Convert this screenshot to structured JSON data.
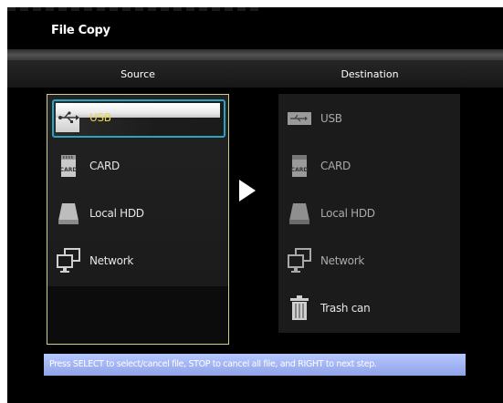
{
  "window": {
    "title": "File Copy"
  },
  "header": {
    "source_label": "Source",
    "destination_label": "Destination"
  },
  "source": {
    "selected_index": 0,
    "items": [
      {
        "label": "USB",
        "icon": "usb-icon"
      },
      {
        "label": "CARD",
        "icon": "card-icon"
      },
      {
        "label": "Local HDD",
        "icon": "hdd-icon"
      },
      {
        "label": "Network",
        "icon": "network-icon"
      }
    ]
  },
  "destination": {
    "items": [
      {
        "label": "USB",
        "icon": "usb-icon"
      },
      {
        "label": "CARD",
        "icon": "card-icon"
      },
      {
        "label": "Local HDD",
        "icon": "hdd-icon"
      },
      {
        "label": "Network",
        "icon": "network-icon"
      },
      {
        "label": "Trash can",
        "icon": "trash-icon"
      }
    ]
  },
  "hint": {
    "text": "Press SELECT to select/cancel file, STOP to cancel all file, and RIGHT to next step."
  },
  "colors": {
    "selection_border": "#2aa5bf",
    "selected_text": "#e8d84a",
    "hint_bar": "#9fb2f2",
    "panel_border": "#cfcf86"
  }
}
